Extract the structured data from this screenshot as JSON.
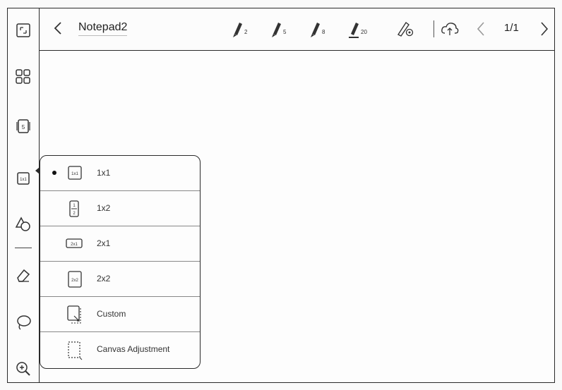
{
  "topbar": {
    "title": "Notepad2",
    "pens": [
      {
        "name": "pen-2",
        "size": "2"
      },
      {
        "name": "pen-5",
        "size": "5"
      },
      {
        "name": "pen-8",
        "size": "8"
      },
      {
        "name": "pen-20",
        "size": "20"
      }
    ],
    "page_indicator": "1/1"
  },
  "sidebar": {
    "items": [
      "expand-icon",
      "grid-icon",
      "page-icon",
      "layout-icon",
      "shapes-icon",
      "eraser-icon",
      "lasso-icon",
      "zoom-in-icon"
    ]
  },
  "layout_menu": {
    "selected": "1x1",
    "options": [
      {
        "id": "1x1",
        "label": "1x1",
        "icon": "layout-1x1-icon"
      },
      {
        "id": "1x2",
        "label": "1x2",
        "icon": "layout-1x2-icon"
      },
      {
        "id": "2x1",
        "label": "2x1",
        "icon": "layout-2x1-icon"
      },
      {
        "id": "2x2",
        "label": "2x2",
        "icon": "layout-2x2-icon"
      },
      {
        "id": "custom",
        "label": "Custom",
        "icon": "custom-layout-icon"
      },
      {
        "id": "canvas",
        "label": "Canvas Adjustment",
        "icon": "canvas-adjustment-icon"
      }
    ]
  }
}
